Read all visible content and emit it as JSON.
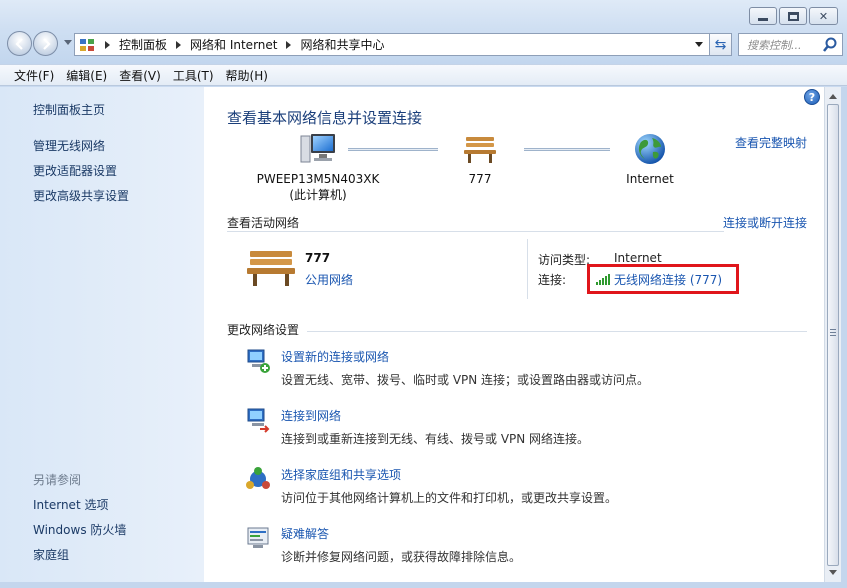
{
  "window": {
    "controls": [
      "minimize",
      "maximize",
      "close"
    ]
  },
  "address": {
    "crumbs": [
      "控制面板",
      "网络和 Internet",
      "网络和共享中心"
    ],
    "search_placeholder": "搜索控制..."
  },
  "menu": [
    "文件(F)",
    "编辑(E)",
    "查看(V)",
    "工具(T)",
    "帮助(H)"
  ],
  "sidebar": {
    "items": [
      "控制面板主页",
      "管理无线网络",
      "更改适配器设置",
      "更改高级共享设置"
    ],
    "see_also_label": "另请参阅",
    "see_also": [
      "Internet 选项",
      "Windows 防火墙",
      "家庭组"
    ]
  },
  "main": {
    "title": "查看基本网络信息并设置连接",
    "full_map_link": "查看完整映射",
    "map": {
      "computer_name": "PWEEP13M5N403XK",
      "computer_sub": "(此计算机)",
      "network_name": "777",
      "internet_label": "Internet"
    },
    "active_section": "查看活动网络",
    "connect_disconnect_link": "连接或断开连接",
    "active_network": {
      "name": "777",
      "type": "公用网络",
      "access_type_label": "访问类型:",
      "access_type_value": "Internet",
      "connection_label": "连接:",
      "connection_value": "无线网络连接 (777)"
    },
    "change_section": "更改网络设置",
    "tasks": [
      {
        "title": "设置新的连接或网络",
        "desc": "设置无线、宽带、拨号、临时或 VPN 连接；或设置路由器或访问点。",
        "icon": "new-connection-icon"
      },
      {
        "title": "连接到网络",
        "desc": "连接到或重新连接到无线、有线、拨号或 VPN 网络连接。",
        "icon": "connect-network-icon"
      },
      {
        "title": "选择家庭组和共享选项",
        "desc": "访问位于其他网络计算机上的文件和打印机，或更改共享设置。",
        "icon": "homegroup-icon"
      },
      {
        "title": "疑难解答",
        "desc": "诊断并修复网络问题，或获得故障排除信息。",
        "icon": "troubleshoot-icon"
      }
    ]
  },
  "colors": {
    "link": "#1a56b0",
    "title": "#1a3e7a",
    "highlight_box": "#e0161b",
    "sidebar_bg": "#dfeaf8"
  }
}
